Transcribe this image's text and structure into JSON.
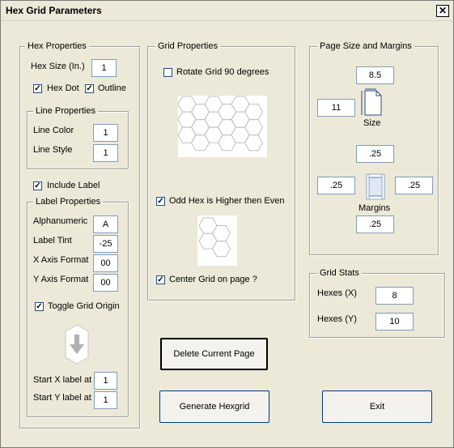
{
  "window": {
    "title": "Hex Grid Parameters",
    "close_glyph": "✕"
  },
  "hex_properties": {
    "title": "Hex Properties",
    "hex_size_label": "Hex Size (In.)",
    "hex_size_value": "1",
    "hex_dot_label": "Hex Dot",
    "hex_dot_checked": true,
    "outline_label": "Outline",
    "outline_checked": true
  },
  "line_properties": {
    "title": "Line Properties",
    "line_color_label": "Line Color",
    "line_color_value": "1",
    "line_style_label": "Line Style",
    "line_style_value": "1"
  },
  "include_label": {
    "label": "Include Label",
    "checked": true
  },
  "label_properties": {
    "title": "Label Properties",
    "alphanumeric_label": "Alphanumeric",
    "alphanumeric_value": "A",
    "label_tint_label": "Label Tint",
    "label_tint_value": "-25",
    "x_axis_format_label": "X Axis Format",
    "x_axis_format_value": "00",
    "y_axis_format_label": "Y Axis Format",
    "y_axis_format_value": "00",
    "toggle_origin_label": "Toggle Grid Origin",
    "toggle_origin_checked": true,
    "start_x_label": "Start X label at",
    "start_x_value": "1",
    "start_y_label": "Start Y label at",
    "start_y_value": "1"
  },
  "grid_properties": {
    "title": "Grid Properties",
    "rotate_label": "Rotate Grid 90 degrees",
    "rotate_checked": false,
    "odd_hex_label": "Odd Hex is Higher then Even",
    "odd_hex_checked": true,
    "center_label": "Center Grid on page ?",
    "center_checked": true
  },
  "page_size": {
    "title": "Page Size and Margins",
    "width_value": "8.5",
    "height_value": "11",
    "size_caption": "Size",
    "margin_top": ".25",
    "margin_left": ".25",
    "margin_right": ".25",
    "margin_bottom": ".25",
    "margins_caption": "Margins"
  },
  "grid_stats": {
    "title": "Grid Stats",
    "hexes_x_label": "Hexes (X)",
    "hexes_x_value": "8",
    "hexes_y_label": "Hexes (Y)",
    "hexes_y_value": "10"
  },
  "buttons": {
    "delete_page": "Delete Current Page",
    "generate": "Generate Hexgrid",
    "exit": "Exit"
  }
}
